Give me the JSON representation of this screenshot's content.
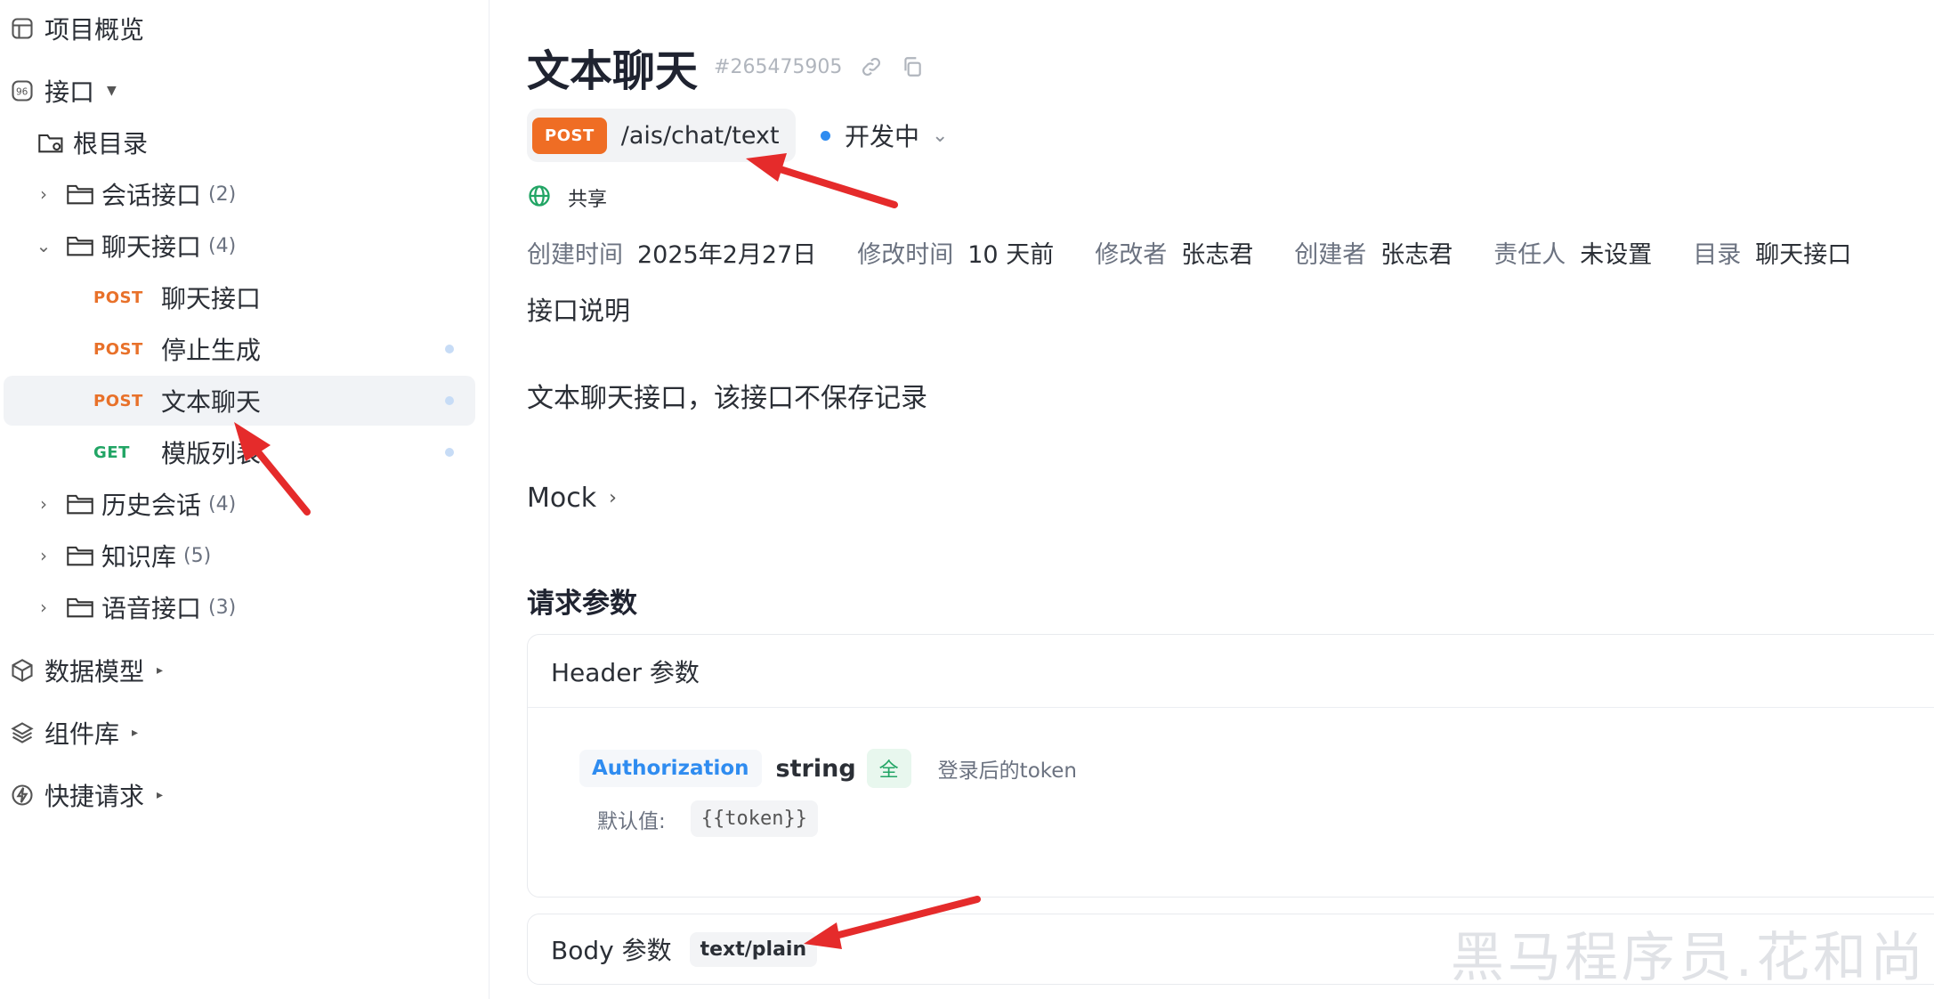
{
  "sidebar": {
    "overview": "项目概览",
    "api": "接口",
    "root": "根目录",
    "folders": [
      {
        "label": "会话接口",
        "count": "(2)",
        "expanded": false
      },
      {
        "label": "聊天接口",
        "count": "(4)",
        "expanded": true
      },
      {
        "label": "历史会话",
        "count": "(4)",
        "expanded": false
      },
      {
        "label": "知识库",
        "count": "(5)",
        "expanded": false
      },
      {
        "label": "语音接口",
        "count": "(3)",
        "expanded": false
      }
    ],
    "apis": [
      {
        "method": "POST",
        "label": "聊天接口"
      },
      {
        "method": "POST",
        "label": "停止生成"
      },
      {
        "method": "POST",
        "label": "文本聊天"
      },
      {
        "method": "GET",
        "label": "模版列表"
      }
    ],
    "data_models": "数据模型",
    "components": "组件库",
    "quick_request": "快捷请求"
  },
  "main": {
    "title": "文本聊天",
    "id": "#265475905",
    "method": "POST",
    "path": "/ais/chat/text",
    "status": "开发中",
    "share": "共享",
    "meta": [
      {
        "k": "创建时间",
        "v": "2025年2月27日"
      },
      {
        "k": "修改时间",
        "v": "10 天前"
      },
      {
        "k": "修改者",
        "v": "张志君"
      },
      {
        "k": "创建者",
        "v": "张志君"
      },
      {
        "k": "责任人",
        "v": "未设置"
      },
      {
        "k": "目录",
        "v": "聊天接口"
      }
    ],
    "desc_title": "接口说明",
    "desc_text": "文本聊天接口，该接口不保存记录",
    "mock": "Mock",
    "request_title": "请求参数",
    "header_title": "Header 参数",
    "param": {
      "name": "Authorization",
      "type": "string",
      "required": "全",
      "desc": "登录后的token",
      "default_label": "默认值:",
      "default_value": "{{token}}"
    },
    "body_title": "Body 参数",
    "body_type": "text/plain"
  },
  "colors": {
    "post": "#ef6d24",
    "get": "#22a565",
    "link": "#2f8cf0",
    "annotation": "#e52b2b"
  },
  "watermark": "黑马程序员.花和尚"
}
